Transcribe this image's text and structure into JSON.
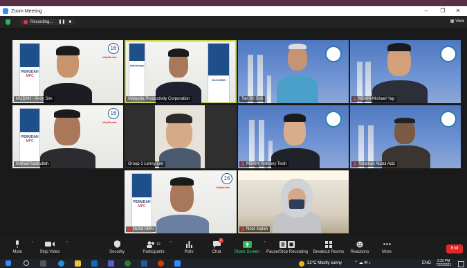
{
  "window": {
    "title": "Zoom Meeting",
    "controls": [
      "–",
      "❐",
      "✕"
    ]
  },
  "status": {
    "recording_label": "Recording...",
    "pause_icon": "❚❚",
    "stop_icon": "■",
    "view_label": "View"
  },
  "tiles": [
    {
      "name": "MUDAH - Andy Sim",
      "muted": false,
      "banner_text": "PEMUDAH",
      "banner_sub": "MPC",
      "badge": "16",
      "tag": "#MyMudah"
    },
    {
      "name": "Malaysia Productivity Corporation",
      "muted": false,
      "banner_text": "#abdulmpc",
      "banner_sub": "HACUMEN",
      "tag": ""
    },
    {
      "name": "Tan Sri Soh",
      "muted": false,
      "logo": "MBAM"
    },
    {
      "name": "MBAM-Michael Yap",
      "muted": true,
      "logo": "MBAM"
    },
    {
      "name": "Mahadi hasbullah",
      "muted": false,
      "banner_text": "PEMUDAH",
      "banner_sub": "MPC",
      "badge": "16",
      "tag": "#MyMudah"
    },
    {
      "name": "Group 1 Lenny Lim",
      "muted": false
    },
    {
      "name": "MBAM- Anthony Teoh",
      "muted": true,
      "logo": "MBAM"
    },
    {
      "name": "Astaman Abdul Aziz",
      "muted": true,
      "logo": "MBAM"
    },
    {
      "name": "Mohd Hilmi",
      "muted": true,
      "banner_text": "PEMUDAH",
      "banner_sub": "MPC",
      "badge": "16",
      "tag": "#MyMudah"
    },
    {
      "name": "Noor Aqilah",
      "muted": true
    }
  ],
  "toolbar": {
    "mute": "Mute",
    "stop_video": "Stop Video",
    "security": "Security",
    "participants": "Participants",
    "participants_count": "12",
    "polls": "Polls",
    "chat": "Chat",
    "chat_badge": "1",
    "share_screen": "Share Screen",
    "recording": "Pause/Stop Recording",
    "breakout": "Breakout Rooms",
    "reactions": "Reactions",
    "more": "More",
    "end": "End"
  },
  "taskbar": {
    "weather": "32°C  Mostly sunny",
    "lang": "ENG",
    "time": "3:33 PM",
    "date": "7/22/2021"
  },
  "colors": {
    "accent": "#2d8cff",
    "active_speaker": "#c9d842",
    "end": "#e02828",
    "share": "#2fb35a"
  }
}
